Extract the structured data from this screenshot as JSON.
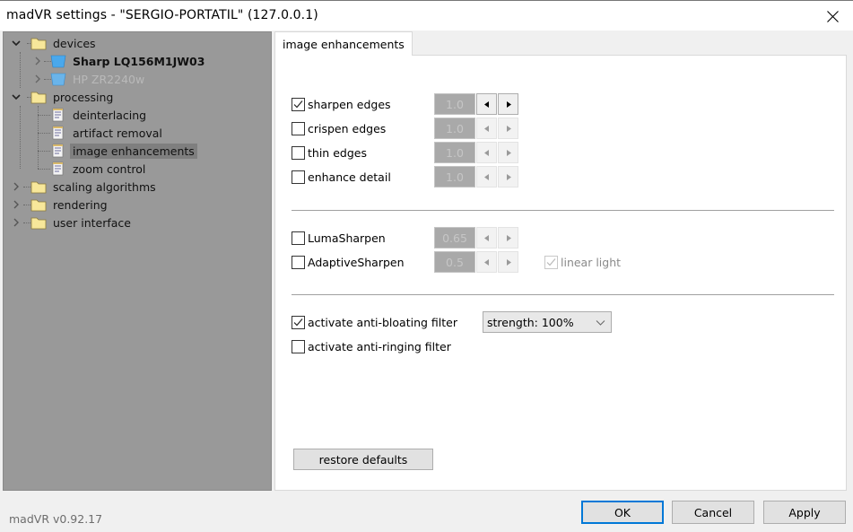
{
  "window": {
    "title": "madVR settings - \"SERGIO-PORTATIL\" (127.0.0.1)",
    "close_icon": "close-icon"
  },
  "tree": {
    "items": [
      {
        "label": "devices",
        "icon": "folder-icon",
        "expanded": true,
        "level": 0
      },
      {
        "label": "Sharp LQ156M1JW03",
        "icon": "monitor-icon",
        "expanded": false,
        "level": 1,
        "bold": true
      },
      {
        "label": "HP ZR2240w",
        "icon": "monitor-icon",
        "expanded": false,
        "level": 1,
        "disabled": true
      },
      {
        "label": "processing",
        "icon": "folder-icon",
        "expanded": true,
        "level": 0
      },
      {
        "label": "deinterlacing",
        "icon": "document-icon",
        "level": 1
      },
      {
        "label": "artifact removal",
        "icon": "document-icon",
        "level": 1
      },
      {
        "label": "image enhancements",
        "icon": "document-icon",
        "level": 1,
        "selected": true
      },
      {
        "label": "zoom control",
        "icon": "document-icon",
        "level": 1
      },
      {
        "label": "scaling algorithms",
        "icon": "folder-icon",
        "expanded": false,
        "level": 0
      },
      {
        "label": "rendering",
        "icon": "folder-icon",
        "expanded": false,
        "level": 0
      },
      {
        "label": "user interface",
        "icon": "folder-icon",
        "expanded": false,
        "level": 0
      }
    ]
  },
  "tab": {
    "label": "image enhancements"
  },
  "group1": [
    {
      "label": "sharpen edges",
      "checked": true,
      "value": "1.0",
      "enabled": true
    },
    {
      "label": "crispen edges",
      "checked": false,
      "value": "1.0",
      "enabled": false
    },
    {
      "label": "thin edges",
      "checked": false,
      "value": "1.0",
      "enabled": false
    },
    {
      "label": "enhance detail",
      "checked": false,
      "value": "1.0",
      "enabled": false
    }
  ],
  "group2": [
    {
      "label": "LumaSharpen",
      "checked": false,
      "value": "0.65",
      "enabled": false
    },
    {
      "label": "AdaptiveSharpen",
      "checked": false,
      "value": "0.5",
      "enabled": false
    }
  ],
  "linear_light": {
    "label": "linear light",
    "checked": true,
    "enabled": false
  },
  "group3": {
    "anti_bloating": {
      "label": "activate anti-bloating filter",
      "checked": true
    },
    "anti_ringing": {
      "label": "activate anti-ringing filter",
      "checked": false
    },
    "strength": {
      "selected": "strength: 100%"
    }
  },
  "buttons": {
    "restore_defaults": "restore defaults",
    "ok": "OK",
    "cancel": "Cancel",
    "apply": "Apply"
  },
  "footer": {
    "version": "madVR v0.92.17"
  },
  "colors": {
    "tree_bg": "#999999",
    "selected_bg": "#7f7f7f",
    "accent": "#0078d7"
  }
}
